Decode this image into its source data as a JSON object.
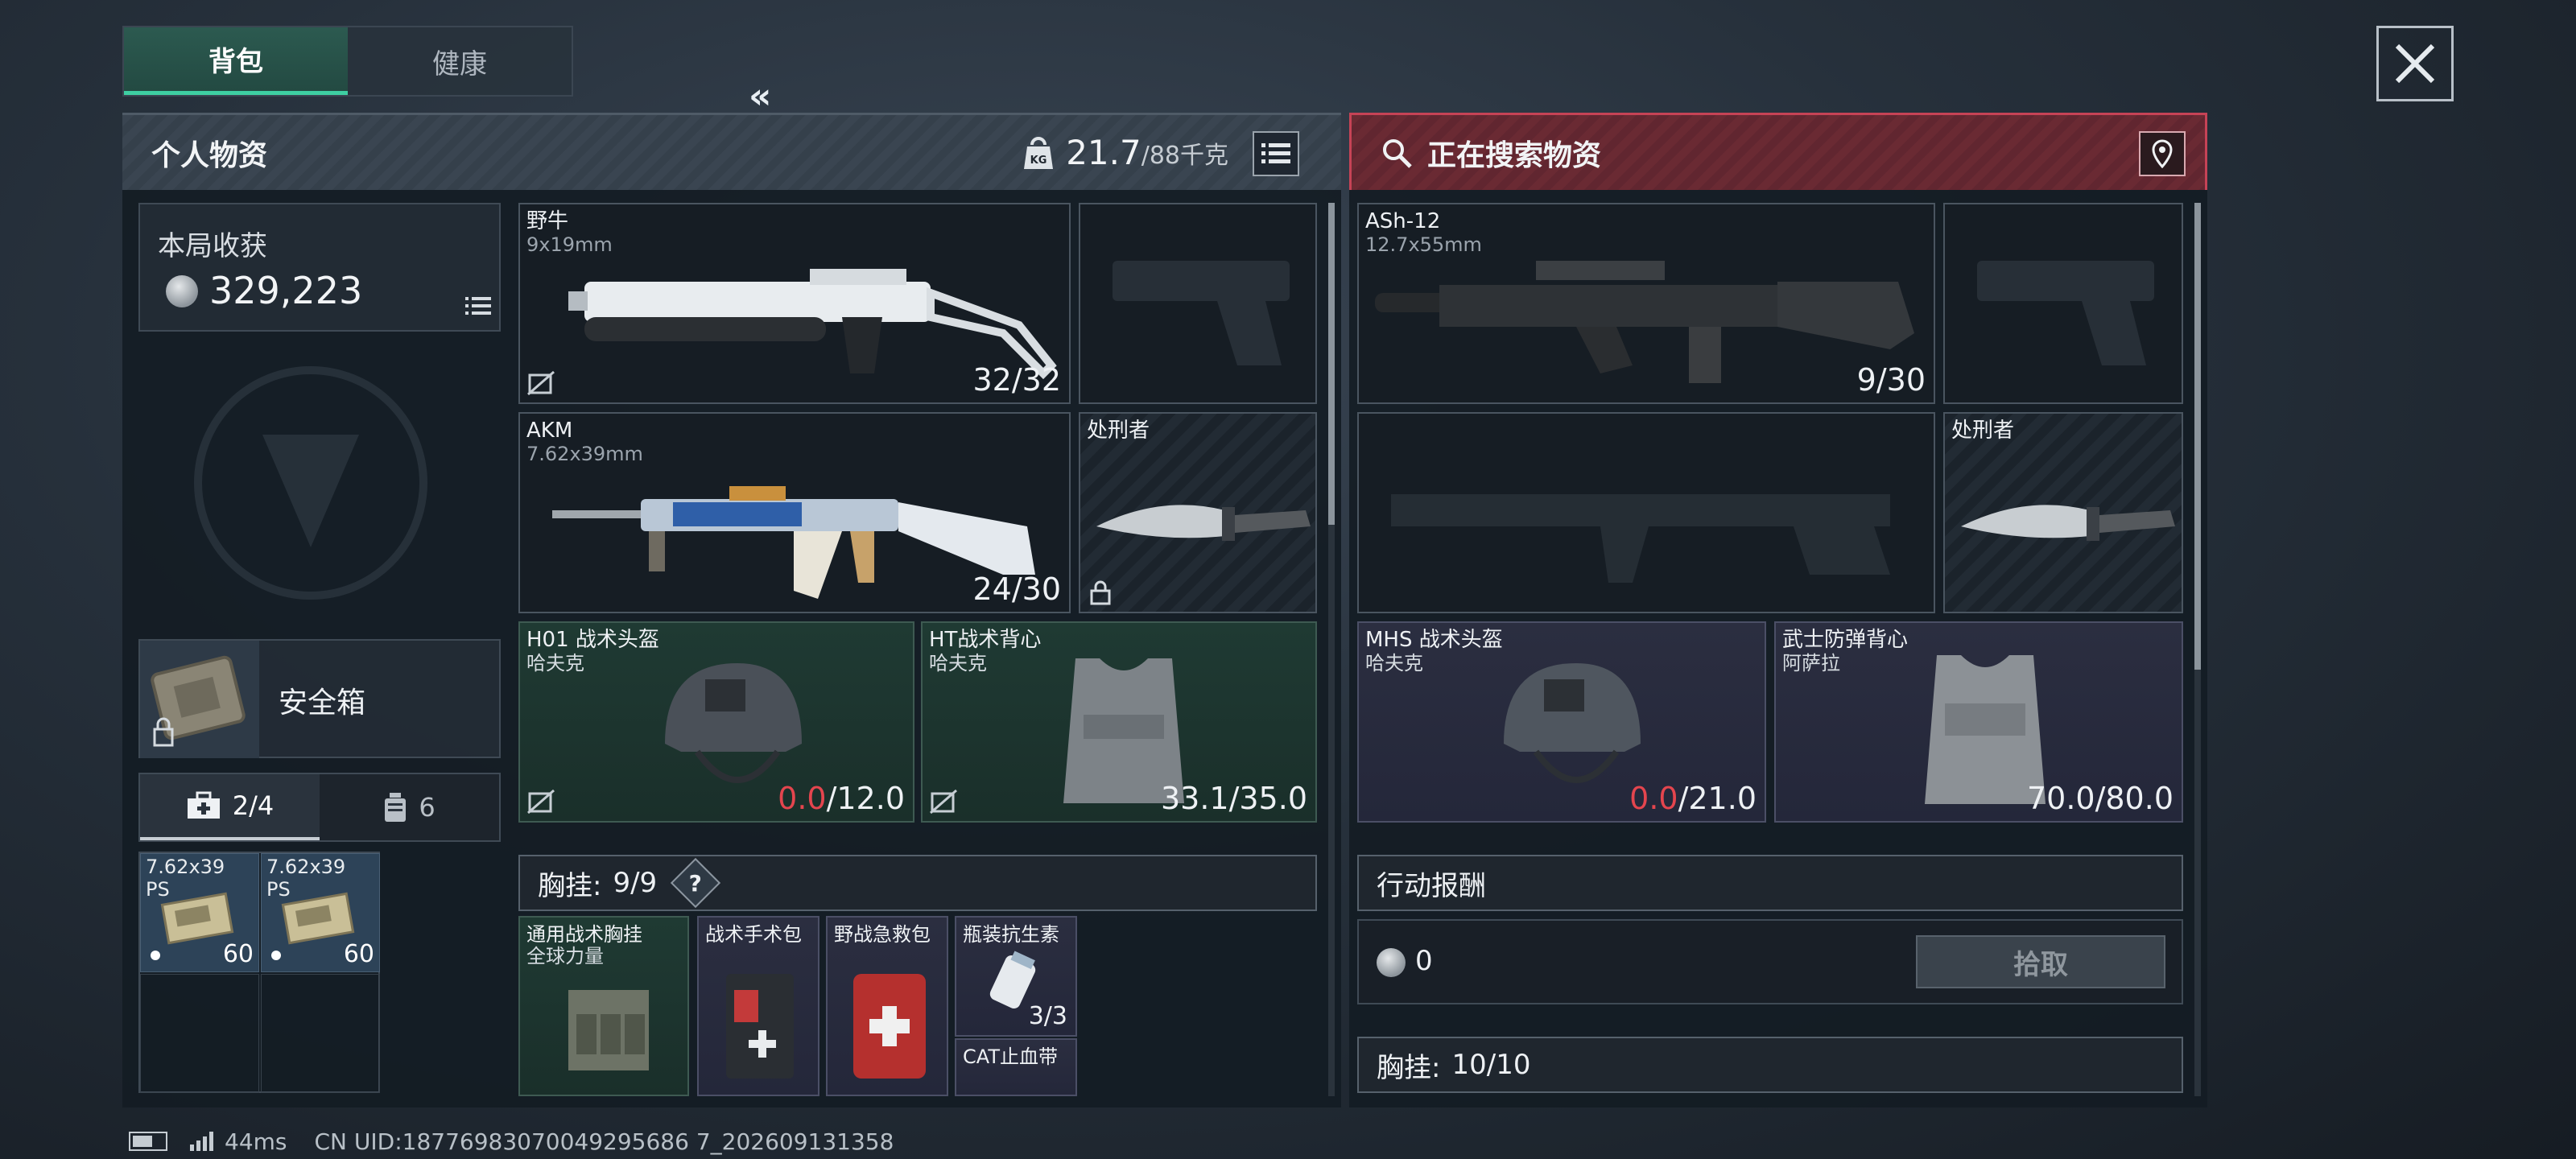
{
  "tabs": {
    "backpack": "背包",
    "health": "健康"
  },
  "left_panel": {
    "title": "个人物资",
    "weight_value": "21.7",
    "weight_max": "/88千克",
    "harvest": {
      "label": "本局收获",
      "value": "329,223"
    },
    "safe_box_label": "安全箱",
    "pouch_tabs": [
      {
        "label": "2/4",
        "icon": "medkit-icon"
      },
      {
        "label": "6",
        "icon": "canister-icon"
      }
    ],
    "ammo": [
      {
        "name": "7.62x39",
        "sub": "PS",
        "qty": "60"
      },
      {
        "name": "7.62x39",
        "sub": "PS",
        "qty": "60"
      }
    ],
    "weapons": [
      {
        "name": "野牛",
        "caliber": "9x19mm",
        "qty": "32/32"
      },
      {
        "name": "AKM",
        "caliber": "7.62x39mm",
        "qty": "24/30"
      }
    ],
    "melee": {
      "name": "处刑者"
    },
    "helmet": {
      "name": "H01 战术头盔",
      "brand": "哈夫克",
      "dur_cur": "0.0",
      "dur_max": "/12.0"
    },
    "vest": {
      "name": "HT战术背心",
      "brand": "哈夫克",
      "dur": "33.1/35.0"
    },
    "chest_rig_bar": {
      "label": "胸挂:",
      "count": "9/9",
      "help": "?"
    },
    "rig_items": [
      {
        "name": "通用战术胸挂",
        "sub": "全球力量"
      },
      {
        "name": "战术手术包",
        "sub": ""
      },
      {
        "name": "野战急救包",
        "sub": ""
      },
      {
        "name": "瓶装抗生素",
        "sub": "",
        "qty": "3/3"
      },
      {
        "name": "CAT止血带",
        "sub": ""
      }
    ]
  },
  "right_panel": {
    "title": "正在搜索物资",
    "weapon": {
      "name": "ASh-12",
      "caliber": "12.7x55mm",
      "qty": "9/30"
    },
    "melee": {
      "name": "处刑者"
    },
    "helmet": {
      "name": "MHS 战术头盔",
      "brand": "哈夫克",
      "dur_cur": "0.0",
      "dur_max": "/21.0"
    },
    "vest": {
      "name": "武士防弹背心",
      "brand": "阿萨拉",
      "dur": "70.0/80.0"
    },
    "rewards_label": "行动报酬",
    "rewards_value": "0",
    "pickup_label": "拾取",
    "chest_rig_bar": {
      "label": "胸挂:",
      "count": "10/10"
    }
  },
  "status_bar": {
    "ping": "44ms",
    "uid": "CN UID:18776983070049295686 7_202609131358"
  },
  "colors": {
    "accent_green": "#3ecfa2",
    "accent_red": "#c64356",
    "durability_red": "#e4454e"
  }
}
